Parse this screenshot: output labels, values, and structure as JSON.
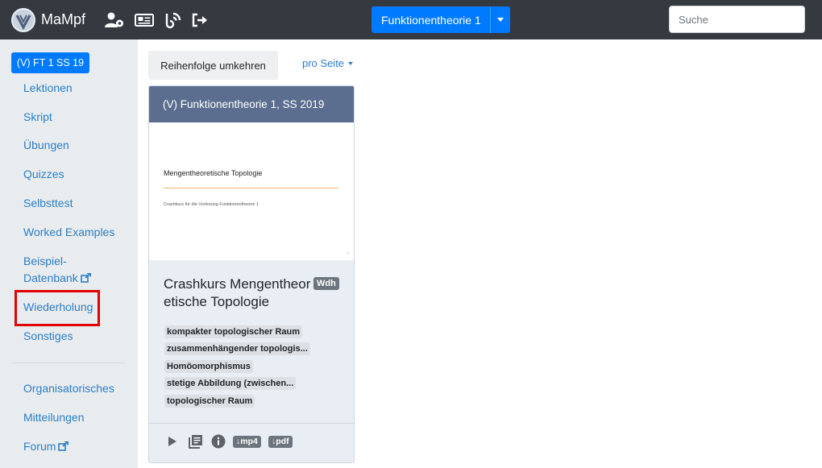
{
  "navbar": {
    "brand": "MaMpf",
    "icons": [
      "admin-user-gear-icon",
      "news-icon",
      "blog-feed-icon",
      "logout-icon"
    ],
    "course_button": "Funktionentheorie 1",
    "search_placeholder": "Suche"
  },
  "sidebar": {
    "course_badge": "(V) FT 1 SS 19",
    "items": [
      {
        "label": "Lektionen"
      },
      {
        "label": "Skript"
      },
      {
        "label": "Übungen"
      },
      {
        "label": "Quizzes"
      },
      {
        "label": "Selbsttest"
      },
      {
        "label": "Worked Examples"
      },
      {
        "label": "Beispiel-"
      },
      {
        "label": "Datenbank"
      },
      {
        "label": "Wiederholung"
      },
      {
        "label": "Sonstiges"
      }
    ],
    "items2": [
      {
        "label": "Organisatorisches"
      },
      {
        "label": "Mitteilungen"
      },
      {
        "label": "Forum"
      }
    ],
    "highlight_color": "#e00000"
  },
  "main": {
    "reverse_button": "Reihenfolge umkehren",
    "per_page": "pro Seite",
    "card": {
      "header": "(V) Funktionentheorie 1, SS 2019",
      "thumbnail": {
        "title": "Mengentheoretische Topologie",
        "subtitle": "Crashkurs für die Vorlesung Funktionentheorie 1",
        "page": "1"
      },
      "title": "Crashkurs Mengentheoretische Topologie",
      "badge": "Wdh",
      "tags": [
        "kompakter topologischer Raum",
        "zusammenhängender topologis...",
        "Homöomorphismus",
        "stetige Abbildung (zwischen...",
        "topologischer Raum"
      ],
      "footer": {
        "mp4": "↓mp4",
        "pdf": "↓pdf"
      }
    }
  },
  "colors": {
    "navbar": "#343a40",
    "primary": "#007bff",
    "link": "#2a7ec6",
    "card_header": "#5c6e8f"
  }
}
